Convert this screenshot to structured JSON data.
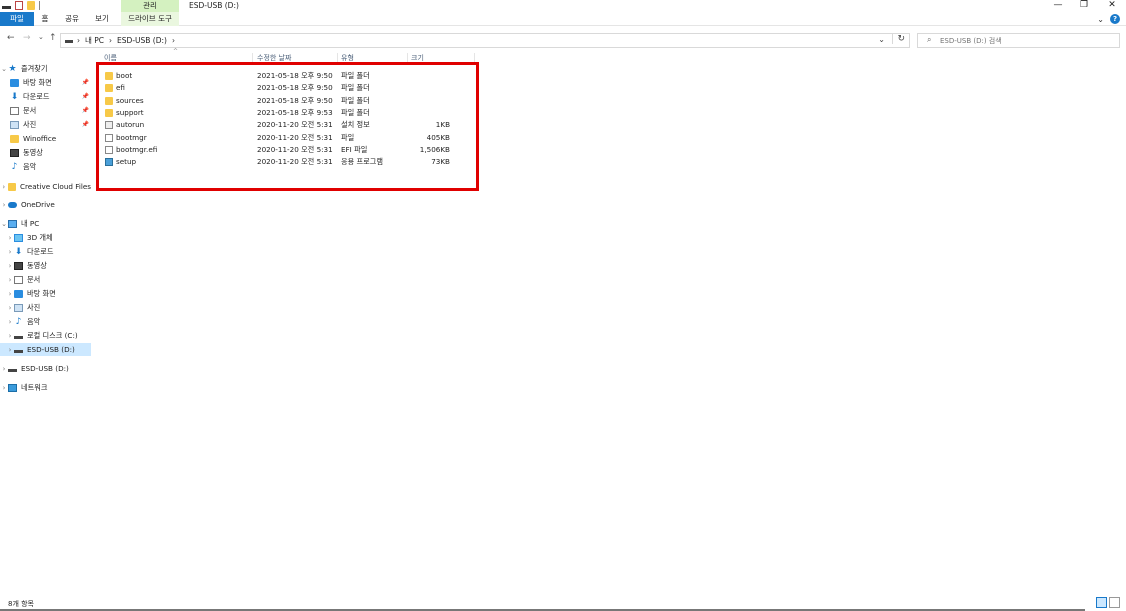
{
  "window": {
    "title": "ESD-USB (D:)",
    "context_group": "관리",
    "min_symbol": "—",
    "max_symbol": "❐",
    "close_symbol": "✕"
  },
  "ribbon": {
    "tabs": [
      "파일",
      "홈",
      "공유",
      "보기",
      "드라이브 도구"
    ],
    "expand_symbol": "⌄",
    "help_symbol": "?"
  },
  "nav": {
    "back": "←",
    "forward": "→",
    "recent": "⌄",
    "up": "↑",
    "breadcrumbs": [
      "›",
      "내 PC",
      "›",
      "ESD-USB (D:)",
      "›"
    ],
    "dropdown": "⌄",
    "refresh": "↻"
  },
  "search": {
    "placeholder": "ESD-USB (D:) 검색",
    "icon": "search-icon",
    "glyph": "⌕"
  },
  "sidebar": {
    "expand_glyph": "›",
    "open_glyph": "⌄",
    "pin_glyph": "📌",
    "quick_access": {
      "label": "즐겨찾기",
      "items": [
        {
          "label": "바탕 화면",
          "icon": "desktop-icon",
          "pinned": true
        },
        {
          "label": "다운로드",
          "icon": "download-icon",
          "pinned": true
        },
        {
          "label": "문서",
          "icon": "document-icon",
          "pinned": true
        },
        {
          "label": "사진",
          "icon": "picture-icon",
          "pinned": true
        },
        {
          "label": "Winoffice",
          "icon": "folder-icon",
          "pinned": false
        },
        {
          "label": "동영상",
          "icon": "video-icon",
          "pinned": false
        },
        {
          "label": "음악",
          "icon": "music-icon",
          "pinned": false
        }
      ]
    },
    "creative_cloud": "Creative Cloud Files",
    "onedrive": "OneDrive",
    "this_pc": {
      "label": "내 PC",
      "items": [
        {
          "label": "3D 개체",
          "icon": "3d-objects-icon"
        },
        {
          "label": "다운로드",
          "icon": "download-icon"
        },
        {
          "label": "동영상",
          "icon": "video-icon"
        },
        {
          "label": "문서",
          "icon": "document-icon"
        },
        {
          "label": "바탕 화면",
          "icon": "desktop-icon"
        },
        {
          "label": "사진",
          "icon": "picture-icon"
        },
        {
          "label": "음악",
          "icon": "music-icon"
        },
        {
          "label": "로컬 디스크 (C:)",
          "icon": "drive-icon"
        },
        {
          "label": "ESD-USB (D:)",
          "icon": "drive-icon",
          "selected": true
        }
      ]
    },
    "usb_drive": "ESD-USB (D:)",
    "network": "네트워크",
    "star_glyph": "★",
    "down_glyph": "⬇",
    "music_glyph": "♪"
  },
  "columns": {
    "name": "이름",
    "date": "수정한 날짜",
    "type": "유형",
    "size": "크기",
    "sort_glyph": "^"
  },
  "files": [
    {
      "name": "boot",
      "date": "2021-05-18 오후 9:50",
      "type": "파일 폴더",
      "size": "",
      "icon": "folder-icon"
    },
    {
      "name": "efi",
      "date": "2021-05-18 오후 9:50",
      "type": "파일 폴더",
      "size": "",
      "icon": "folder-icon"
    },
    {
      "name": "sources",
      "date": "2021-05-18 오후 9:50",
      "type": "파일 폴더",
      "size": "",
      "icon": "folder-icon"
    },
    {
      "name": "support",
      "date": "2021-05-18 오후 9:53",
      "type": "파일 폴더",
      "size": "",
      "icon": "folder-icon"
    },
    {
      "name": "autorun",
      "date": "2020-11-20 오전 5:31",
      "type": "설치 정보",
      "size": "1KB",
      "icon": "setup-info-icon"
    },
    {
      "name": "bootmgr",
      "date": "2020-11-20 오전 5:31",
      "type": "파일",
      "size": "405KB",
      "icon": "file-icon"
    },
    {
      "name": "bootmgr.efi",
      "date": "2020-11-20 오전 5:31",
      "type": "EFI 파일",
      "size": "1,506KB",
      "icon": "file-icon"
    },
    {
      "name": "setup",
      "date": "2020-11-20 오전 5:31",
      "type": "응용 프로그램",
      "size": "73KB",
      "icon": "application-icon"
    }
  ],
  "status": {
    "item_count": "8개 항목"
  },
  "colors": {
    "accent": "#1979ca",
    "highlight_border": "#e00000",
    "selection": "#cce8ff",
    "context_tab": "#d4f1c0"
  }
}
